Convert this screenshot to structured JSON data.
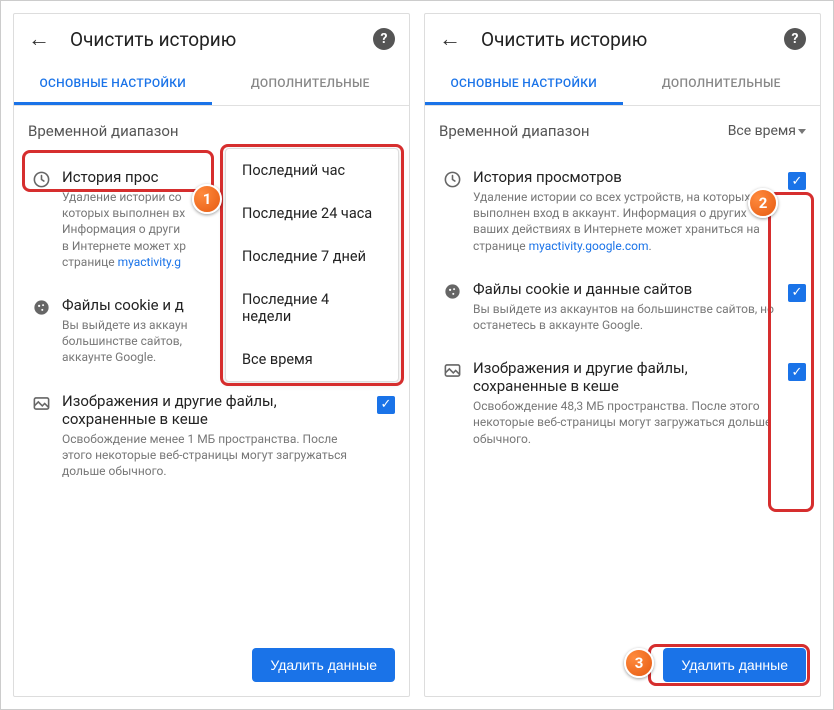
{
  "header": {
    "title": "Очистить историю"
  },
  "tabs": {
    "basic": "ОСНОВНЫЕ НАСТРОЙКИ",
    "advanced": "ДОПОЛНИТЕЛЬНЫЕ"
  },
  "range": {
    "label": "Временной диапазон",
    "value": "Все время"
  },
  "dropdown": {
    "items": [
      "Последний час",
      "Последние 24 часа",
      "Последние 7 дней",
      "Последние 4 недели",
      "Все время"
    ]
  },
  "left": {
    "opt1": {
      "title": "История прос",
      "sub1": "Удаление истории со",
      "sub2": "которых выполнен вх",
      "sub3": "Информация о други",
      "sub4": "в Интернете может хр",
      "sub5": "странице ",
      "link": "myactivity.g"
    },
    "opt2": {
      "title": "Файлы cookie и д",
      "sub1": "Вы выйдете из аккаун",
      "sub2": "большинстве сайтов,",
      "sub3": "аккаунте Google."
    },
    "opt3": {
      "title": "Изображения и другие файлы, сохраненные в кеше",
      "sub": "Освобождение менее 1 МБ пространства. После этого некоторые веб-страницы могут загружаться дольше обычного."
    }
  },
  "right": {
    "opt1": {
      "title": "История просмотров",
      "sub1": "Удаление истории со всех устройств, на которых выполнен вход в аккаунт. Информация о других ваших действиях в Интернете может храниться на странице ",
      "link": "myactivity.google.com",
      "dot": "."
    },
    "opt2": {
      "title": "Файлы cookie и данные сайтов",
      "sub": "Вы выйдете из аккаунтов на большинстве сайтов, но останетесь в аккаунте Google."
    },
    "opt3": {
      "title": "Изображения и другие файлы, сохраненные в кеше",
      "sub": "Освобождение 48,3 МБ пространства. После этого некоторые веб-страницы могут загружаться дольше обычного."
    }
  },
  "footer": {
    "delete": "Удалить данные"
  },
  "badges": {
    "b1": "1",
    "b2": "2",
    "b3": "3"
  }
}
